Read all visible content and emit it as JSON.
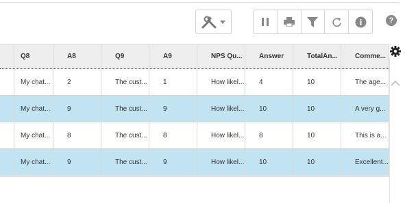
{
  "toolbar": {
    "tools_icon": "hammer-wrench-icon",
    "group_icons": [
      "pause-icon",
      "print-icon",
      "filter-icon",
      "refresh-icon",
      "info-icon"
    ],
    "help_label": "?"
  },
  "grid": {
    "columns": [
      "",
      "Q8",
      "A8",
      "Q9",
      "A9",
      "NPS Qu...",
      "Answer",
      "TotalAn...",
      "Comme..."
    ],
    "rows": [
      {
        "selected": false,
        "cells": [
          "",
          "My chat...",
          "2",
          "The cust...",
          "1",
          "How likel...",
          "4",
          "10",
          "The age..."
        ]
      },
      {
        "selected": true,
        "cells": [
          "",
          "My chat...",
          "9",
          "The cust...",
          "9",
          "How likel...",
          "10",
          "10",
          "A very g..."
        ]
      },
      {
        "selected": false,
        "cells": [
          "",
          "My chat...",
          "8",
          "The cust...",
          "8",
          "How likel...",
          "8",
          "10",
          "This is a..."
        ]
      },
      {
        "selected": true,
        "cells": [
          "",
          "My chat...",
          "9",
          "The cust...",
          "9",
          "How likel...",
          "10",
          "10",
          "Excellent..."
        ]
      }
    ]
  },
  "colors": {
    "selected_row": "#c2e3f1",
    "header_bg": "#eeeeee"
  }
}
